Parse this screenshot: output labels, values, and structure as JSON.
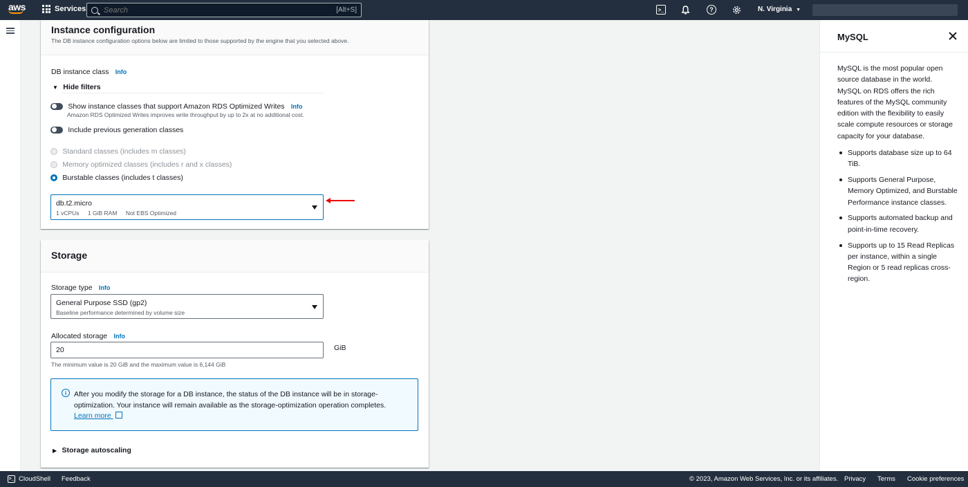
{
  "topnav": {
    "logo": "aws",
    "services": "Services",
    "search_placeholder": "Search",
    "search_shortcut": "[Alt+S]",
    "region": "N. Virginia",
    "icons": [
      "cloudshell-icon",
      "bell-icon",
      "help-icon",
      "gear-icon"
    ]
  },
  "instance_config": {
    "title": "Instance configuration",
    "subtitle": "The DB instance configuration options below are limited to those supported by the engine that you selected above.",
    "db_class_label": "DB instance class",
    "info": "Info",
    "hide_filters": "Hide filters",
    "opt_writes_label": "Show instance classes that support Amazon RDS Optimized Writes",
    "opt_writes_caption": "Amazon RDS Optimized Writes improves write throughput by up to 2x at no additional cost.",
    "prev_gen_label": "Include previous generation classes",
    "radios": [
      {
        "label": "Standard classes (includes m classes)",
        "selected": false,
        "disabled": true
      },
      {
        "label": "Memory optimized classes (includes r and x classes)",
        "selected": false,
        "disabled": true
      },
      {
        "label": "Burstable classes (includes t classes)",
        "selected": true,
        "disabled": false
      }
    ],
    "select": {
      "value": "db.t2.micro",
      "vcpu": "1 vCPUs",
      "ram": "1 GiB RAM",
      "ebs": "Not EBS Optimized"
    }
  },
  "storage": {
    "title": "Storage",
    "type_label": "Storage type",
    "info": "Info",
    "type_value": "General Purpose SSD (gp2)",
    "type_caption": "Baseline performance determined by volume size",
    "alloc_label": "Allocated storage",
    "alloc_value": "20",
    "alloc_unit": "GiB",
    "alloc_caption": "The minimum value is 20 GiB and the maximum value is 6,144 GiB",
    "alert_text": "After you modify the storage for a DB instance, the status of the DB instance will be in storage-optimization. Your instance will remain available as the storage-optimization operation completes.",
    "learn_more": "Learn more",
    "autoscaling": "Storage autoscaling"
  },
  "help_panel": {
    "title": "MySQL",
    "description": "MySQL is the most popular open source database in the world. MySQL on RDS offers the rich features of the MySQL community edition with the flexibility to easily scale compute resources or storage capacity for your database.",
    "bullets": [
      "Supports database size up to 64 TiB.",
      "Supports General Purpose, Memory Optimized, and Burstable Performance instance classes.",
      "Supports automated backup and point-in-time recovery.",
      "Supports up to 15 Read Replicas per instance, within a single Region or 5 read replicas cross-region."
    ]
  },
  "footer": {
    "cloudshell": "CloudShell",
    "feedback": "Feedback",
    "copyright": "© 2023, Amazon Web Services, Inc. or its affiliates.",
    "privacy": "Privacy",
    "terms": "Terms",
    "cookies": "Cookie preferences"
  },
  "colors": {
    "nav_bg": "#232f3e",
    "link": "#0073bb",
    "alert_border": "#0073bb",
    "alert_bg": "#f1faff",
    "annotation_arrow": "#ee0000"
  }
}
